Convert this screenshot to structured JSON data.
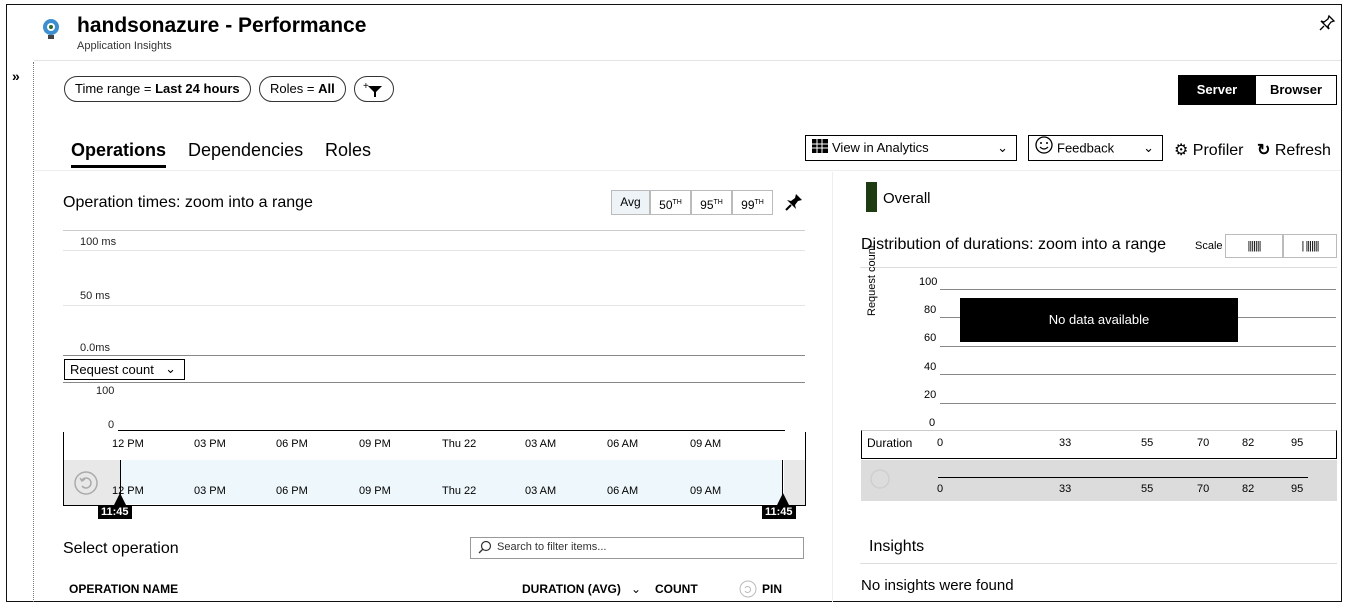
{
  "header": {
    "title": "handsonazure - Performance",
    "subtitle": "Application Insights",
    "expand_icon": "double-chevron-right-icon",
    "pin_icon": "pin-icon"
  },
  "filters": {
    "time_range_prefix": "Time range = ",
    "time_range_value": "Last 24 hours",
    "roles_prefix": "Roles = ",
    "roles_value": "All",
    "add_filter_icon": "add-filter-icon"
  },
  "view_toggle": {
    "server": "Server",
    "browser": "Browser",
    "selected": "Server"
  },
  "tabs": [
    {
      "label": "Operations",
      "active": true
    },
    {
      "label": "Dependencies"
    },
    {
      "label": "Roles"
    }
  ],
  "toolbar": {
    "analytics_label": "View in Analytics",
    "feedback_label": "Feedback",
    "profiler_label": "Profiler",
    "refresh_label": "Refresh"
  },
  "left_chart": {
    "title": "Operation times: zoom into a range",
    "percentiles": [
      "Avg",
      "50TH",
      "95TH",
      "99TH"
    ],
    "selected_percentile": "Avg",
    "y_labels": [
      "100 ms",
      "50 ms",
      "0.0ms"
    ],
    "metric_select": "Request count",
    "count_labels": [
      "100",
      "0"
    ],
    "x_ticks": [
      "12 PM",
      "03 PM",
      "06 PM",
      "09 PM",
      "Thu 22",
      "03 AM",
      "06 AM",
      "09 AM"
    ],
    "range_start": "11:45",
    "range_end": "11:45"
  },
  "operations": {
    "title": "Select operation",
    "search_placeholder": "Search to filter items...",
    "columns": {
      "name": "OPERATION NAME",
      "duration": "DURATION (AVG)",
      "count": "COUNT",
      "pin": "PIN"
    }
  },
  "right_panel": {
    "overall_label": "Overall",
    "distribution_title": "Distribution of durations: zoom into a range",
    "scale_label": "Scale",
    "y_axis_label": "Request count",
    "y_ticks": [
      "100",
      "80",
      "60",
      "40",
      "20",
      "0"
    ],
    "no_data": "No data available",
    "duration_label": "Duration",
    "x_ticks": [
      "0",
      "33",
      "55",
      "70",
      "82",
      "95"
    ],
    "insights_title": "Insights",
    "insights_text": "No insights were found"
  },
  "colors": {
    "overall_swatch": "#1f3b12",
    "selection_fill": "#eef7fb",
    "brush_bg": "#dcdcdc"
  }
}
